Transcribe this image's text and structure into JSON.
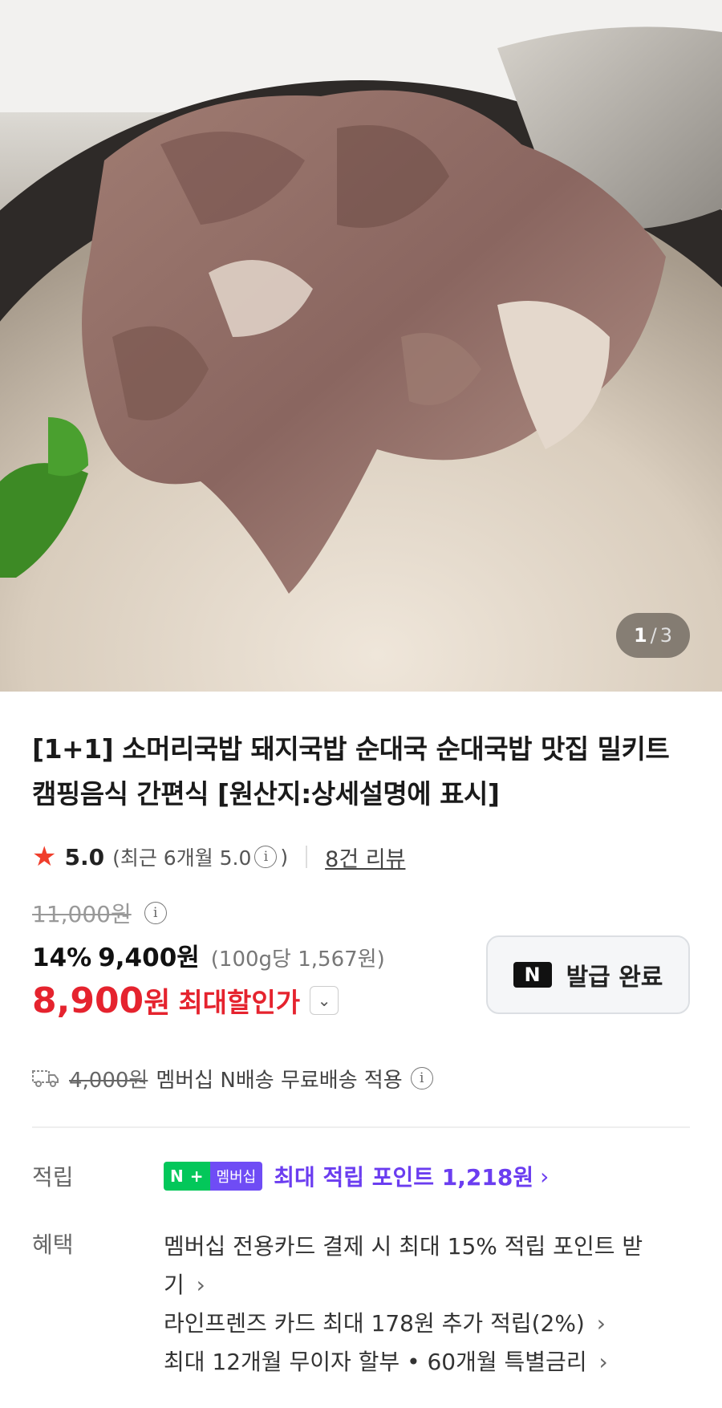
{
  "gallery": {
    "current": "1",
    "separator": "/",
    "total": "3"
  },
  "product": {
    "title": "[1+1] 소머리국밥 돼지국밥 순대국 순대국밥 맛집 밀키트 캠핑음식 간편식 [원산지:상세설명에 표시]"
  },
  "rating": {
    "score": "5.0",
    "recent_prefix": "(최근 6개월 5.0",
    "recent_suffix": ")",
    "info_icon": "i",
    "review_link": "8건 리뷰"
  },
  "price": {
    "original": "11,000원",
    "discount_pct": "14%",
    "discounted": "9,400원",
    "unit_price": "(100g당 1,567원)",
    "final_amount": "8,900",
    "final_won": "원",
    "max_discount_label": "최대할인가",
    "dropdown_icon": "⌄"
  },
  "coupon": {
    "logo": "N",
    "label": "발급 완료"
  },
  "shipping": {
    "old_fee": "4,000원",
    "text": "멤버십 N배송 무료배송 적용"
  },
  "benefits": {
    "points_label": "적립",
    "badge_n": "N",
    "badge_plus": "+",
    "badge_text": "멤버십",
    "points_link": "최대 적립 포인트 1,218원",
    "benefit_label": "혜택",
    "items": [
      "멤버십 전용카드 결제 시 최대 15% 적립 포인트 받기",
      "라인프렌즈 카드 최대 178원 추가 적립(2%)",
      "최대 12개월 무이자 할부 • 60개월 특별금리"
    ],
    "chevron": "›"
  },
  "colors": {
    "sale_red": "#e5232e",
    "star_red": "#f03e2c",
    "naver_green": "#03c75a",
    "membership_purple": "#6b3df0"
  }
}
